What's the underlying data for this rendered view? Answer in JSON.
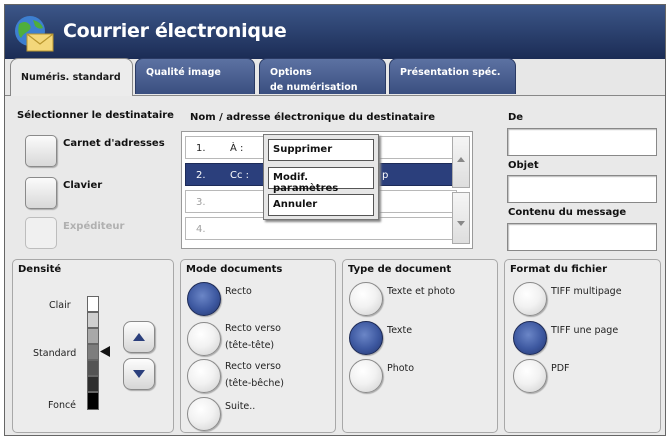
{
  "window": {
    "title": "Courrier électronique",
    "icon": "globe-envelope-icon"
  },
  "tabs": [
    {
      "label": "Numéris. standard",
      "active": true
    },
    {
      "label": "Qualité image",
      "active": false
    },
    {
      "label": "Options\nde numérisation",
      "active": false
    },
    {
      "label": "Présentation spéc.",
      "active": false
    }
  ],
  "recipients": {
    "heading": "Sélectionner le destinataire",
    "address_book": "Carnet d'adresses",
    "keyboard": "Clavier",
    "sender": "Expéditeur",
    "list_heading": "Nom / adresse électronique du destinataire",
    "rows": [
      {
        "num": "1.",
        "type": "À :",
        "value": ""
      },
      {
        "num": "2.",
        "type": "Cc :",
        "value": "p"
      },
      {
        "num": "3.",
        "type": "",
        "value": ""
      },
      {
        "num": "4.",
        "type": "",
        "value": ""
      }
    ],
    "selected_row": 2
  },
  "context_menu": {
    "items": [
      "Supprimer",
      "Modif. paramètres",
      "Annuler"
    ]
  },
  "message": {
    "from_label": "De",
    "from_value": "",
    "subject_label": "Objet",
    "subject_value": "",
    "body_label": "Contenu du message",
    "body_value": ""
  },
  "density": {
    "heading": "Densité",
    "light": "Clair",
    "standard": "Standard",
    "dark": "Foncé",
    "level": "Standard",
    "scale_steps": 7
  },
  "document_mode": {
    "heading": "Mode documents",
    "options": [
      {
        "label": "Recto",
        "selected": true
      },
      {
        "label": "Recto verso\n(tête-tête)",
        "selected": false
      },
      {
        "label": "Recto verso\n(tête-bêche)",
        "selected": false
      },
      {
        "label": "Suite..",
        "selected": false
      }
    ]
  },
  "document_type": {
    "heading": "Type de document",
    "options": [
      {
        "label": "Texte et photo",
        "selected": false
      },
      {
        "label": "Texte",
        "selected": true
      },
      {
        "label": "Photo",
        "selected": false
      }
    ]
  },
  "file_format": {
    "heading": "Format du fichier",
    "options": [
      {
        "label": "TIFF multipage",
        "selected": false
      },
      {
        "label": "TIFF une page",
        "selected": true
      },
      {
        "label": "PDF",
        "selected": false
      }
    ]
  },
  "colors": {
    "title_bar": "#1b2c55",
    "selected": "#2b3f7c",
    "tab": "#4a5f90"
  }
}
